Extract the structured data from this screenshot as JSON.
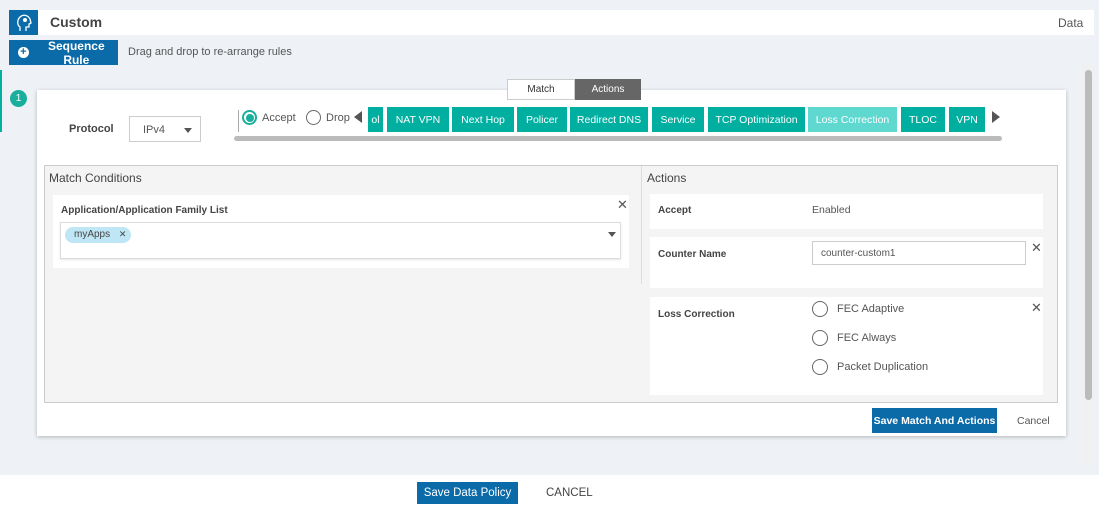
{
  "header": {
    "title": "Custom",
    "right_label": "Data",
    "logo": "head-gear-icon"
  },
  "toolbar": {
    "sequence_rule": "Sequence Rule",
    "hint": "Drag and drop to re-arrange rules"
  },
  "rule": {
    "number": "1",
    "tabs": [
      {
        "label": "Match"
      },
      {
        "label": "Actions",
        "active": true
      }
    ],
    "protocol": {
      "label": "Protocol",
      "value": "IPv4"
    },
    "radio": {
      "accept": "Accept",
      "drop": "Drop",
      "selected": "Accept"
    },
    "action_buttons": [
      "ol",
      "NAT VPN",
      "Next Hop",
      "Policer",
      "Redirect DNS",
      "Service",
      "TCP Optimization",
      "Loss Correction",
      "TLOC",
      "VPN"
    ],
    "selected_action": "Loss Correction",
    "match": {
      "heading": "Match Conditions",
      "field_label": "Application/Application Family List",
      "chips": [
        "myApps"
      ]
    },
    "actions": {
      "heading": "Actions",
      "accept": {
        "label": "Accept",
        "value": "Enabled"
      },
      "counter": {
        "label": "Counter Name",
        "value": "counter-custom1"
      },
      "loss": {
        "label": "Loss Correction",
        "options": [
          "FEC Adaptive",
          "FEC Always",
          "Packet Duplication"
        ]
      }
    },
    "save": "Save Match And Actions",
    "cancel": "Cancel"
  },
  "footer": {
    "save": "Save Data Policy",
    "cancel": "CANCEL"
  },
  "colors": {
    "primary": "#0b6aa8",
    "teal": "#00afa0",
    "teal_selected": "#5fd8d0"
  }
}
